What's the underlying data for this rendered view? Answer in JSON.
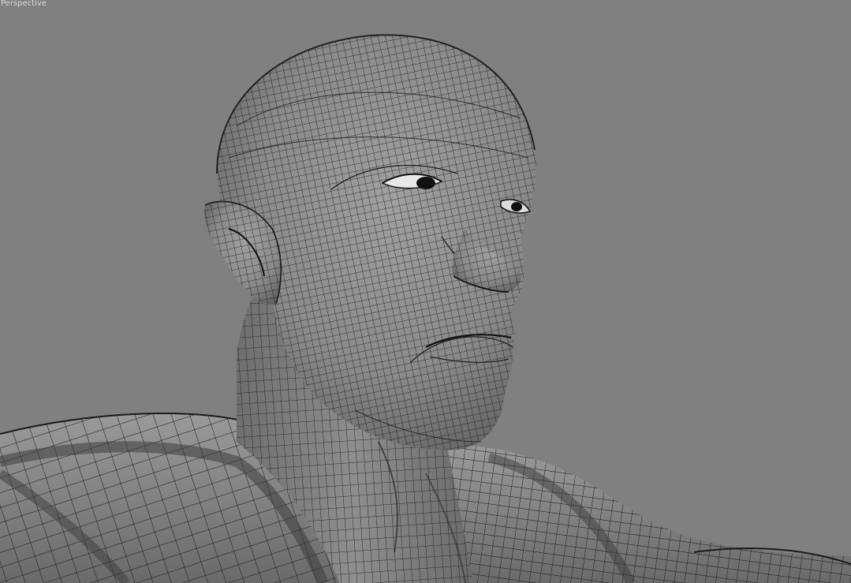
{
  "viewport": {
    "label": "Perspective",
    "background_color": "#808080",
    "mesh_shade_color": "#8c8c8c",
    "wire_color": "#111111"
  }
}
